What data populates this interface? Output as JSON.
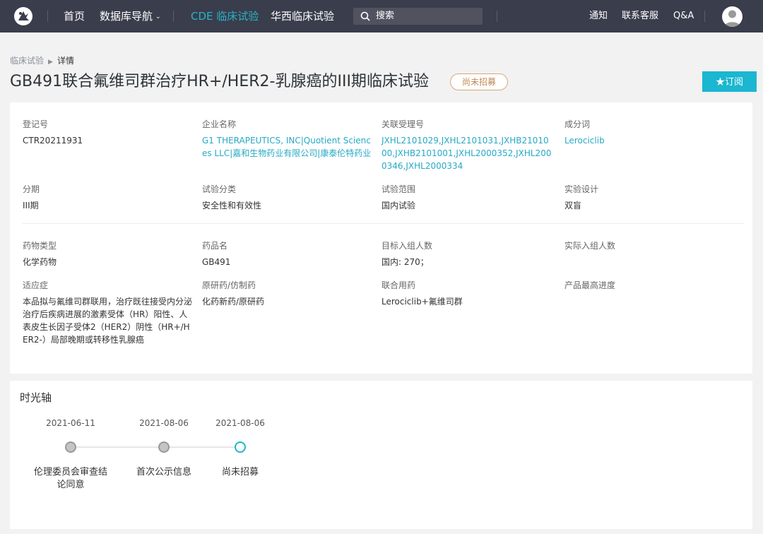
{
  "nav": {
    "logo_icon": "bird-logo-icon",
    "links": [
      "首页",
      "数据库导航",
      "CDE 临床试验",
      "华西临床试验"
    ],
    "active_link": "CDE 临床试验",
    "search_placeholder": "搜索",
    "right_links": [
      "通知",
      "联系客服",
      "Q&A"
    ],
    "accent_color": "#27b3c6"
  },
  "breadcrumb": [
    "临床试验",
    "详情"
  ],
  "title": "GB491联合氟维司群治疗HR+/HER2-乳腺癌的III期临床试验",
  "status_badge": "尚未招募",
  "subscribe_label": "★订阅",
  "fields": [
    {
      "label": "登记号",
      "value": "CTR20211931"
    },
    {
      "label": "企业名称",
      "value": "G1 THERAPEUTICS, INC|Quotient Sciences LLC|嘉和生物药业有限公司|康泰伦特药业"
    },
    {
      "label": "关联受理号",
      "value": "JXHL2101029,JXHL2101031,JXHB2101000,JXHB2101001,JXHL2000352,JXHL2000346,JXHL2000334"
    },
    {
      "label": "成分词",
      "value": "Lerociclib"
    },
    {
      "label": "分期",
      "value": "III期"
    },
    {
      "label": "试验分类",
      "value": "安全性和有效性"
    },
    {
      "label": "试验范围",
      "value": "国内试验"
    },
    {
      "label": "实验设计",
      "value": "双盲"
    },
    {
      "label": "药物类型",
      "value": "化学药物"
    },
    {
      "label": "药品名",
      "value": "GB491"
    },
    {
      "label": "目标入组人数",
      "value": "国内: 270；"
    },
    {
      "label": "实际入组人数",
      "value": ""
    },
    {
      "label": "适应症",
      "value": "本品拟与氟维司群联用，治疗既往接受内分泌治疗后疾病进展的激素受体（HR）阳性、人表皮生长因子受体2（HER2）阴性（HR+/HER2-）局部晚期或转移性乳腺癌"
    },
    {
      "label": "原研药/仿制药",
      "value": "化药新药/原研药"
    },
    {
      "label": "联合用药",
      "value": "Lerociclib+氟维司群"
    },
    {
      "label": "产品最高进度",
      "value": ""
    }
  ],
  "timeline": {
    "title": "时光轴",
    "events": [
      {
        "date": "2021-06-11",
        "label": "伦理委员会审查结论同意"
      },
      {
        "date": "2021-08-06",
        "label": "首次公示信息"
      },
      {
        "date": "2021-08-06",
        "label": "尚未招募"
      }
    ]
  }
}
